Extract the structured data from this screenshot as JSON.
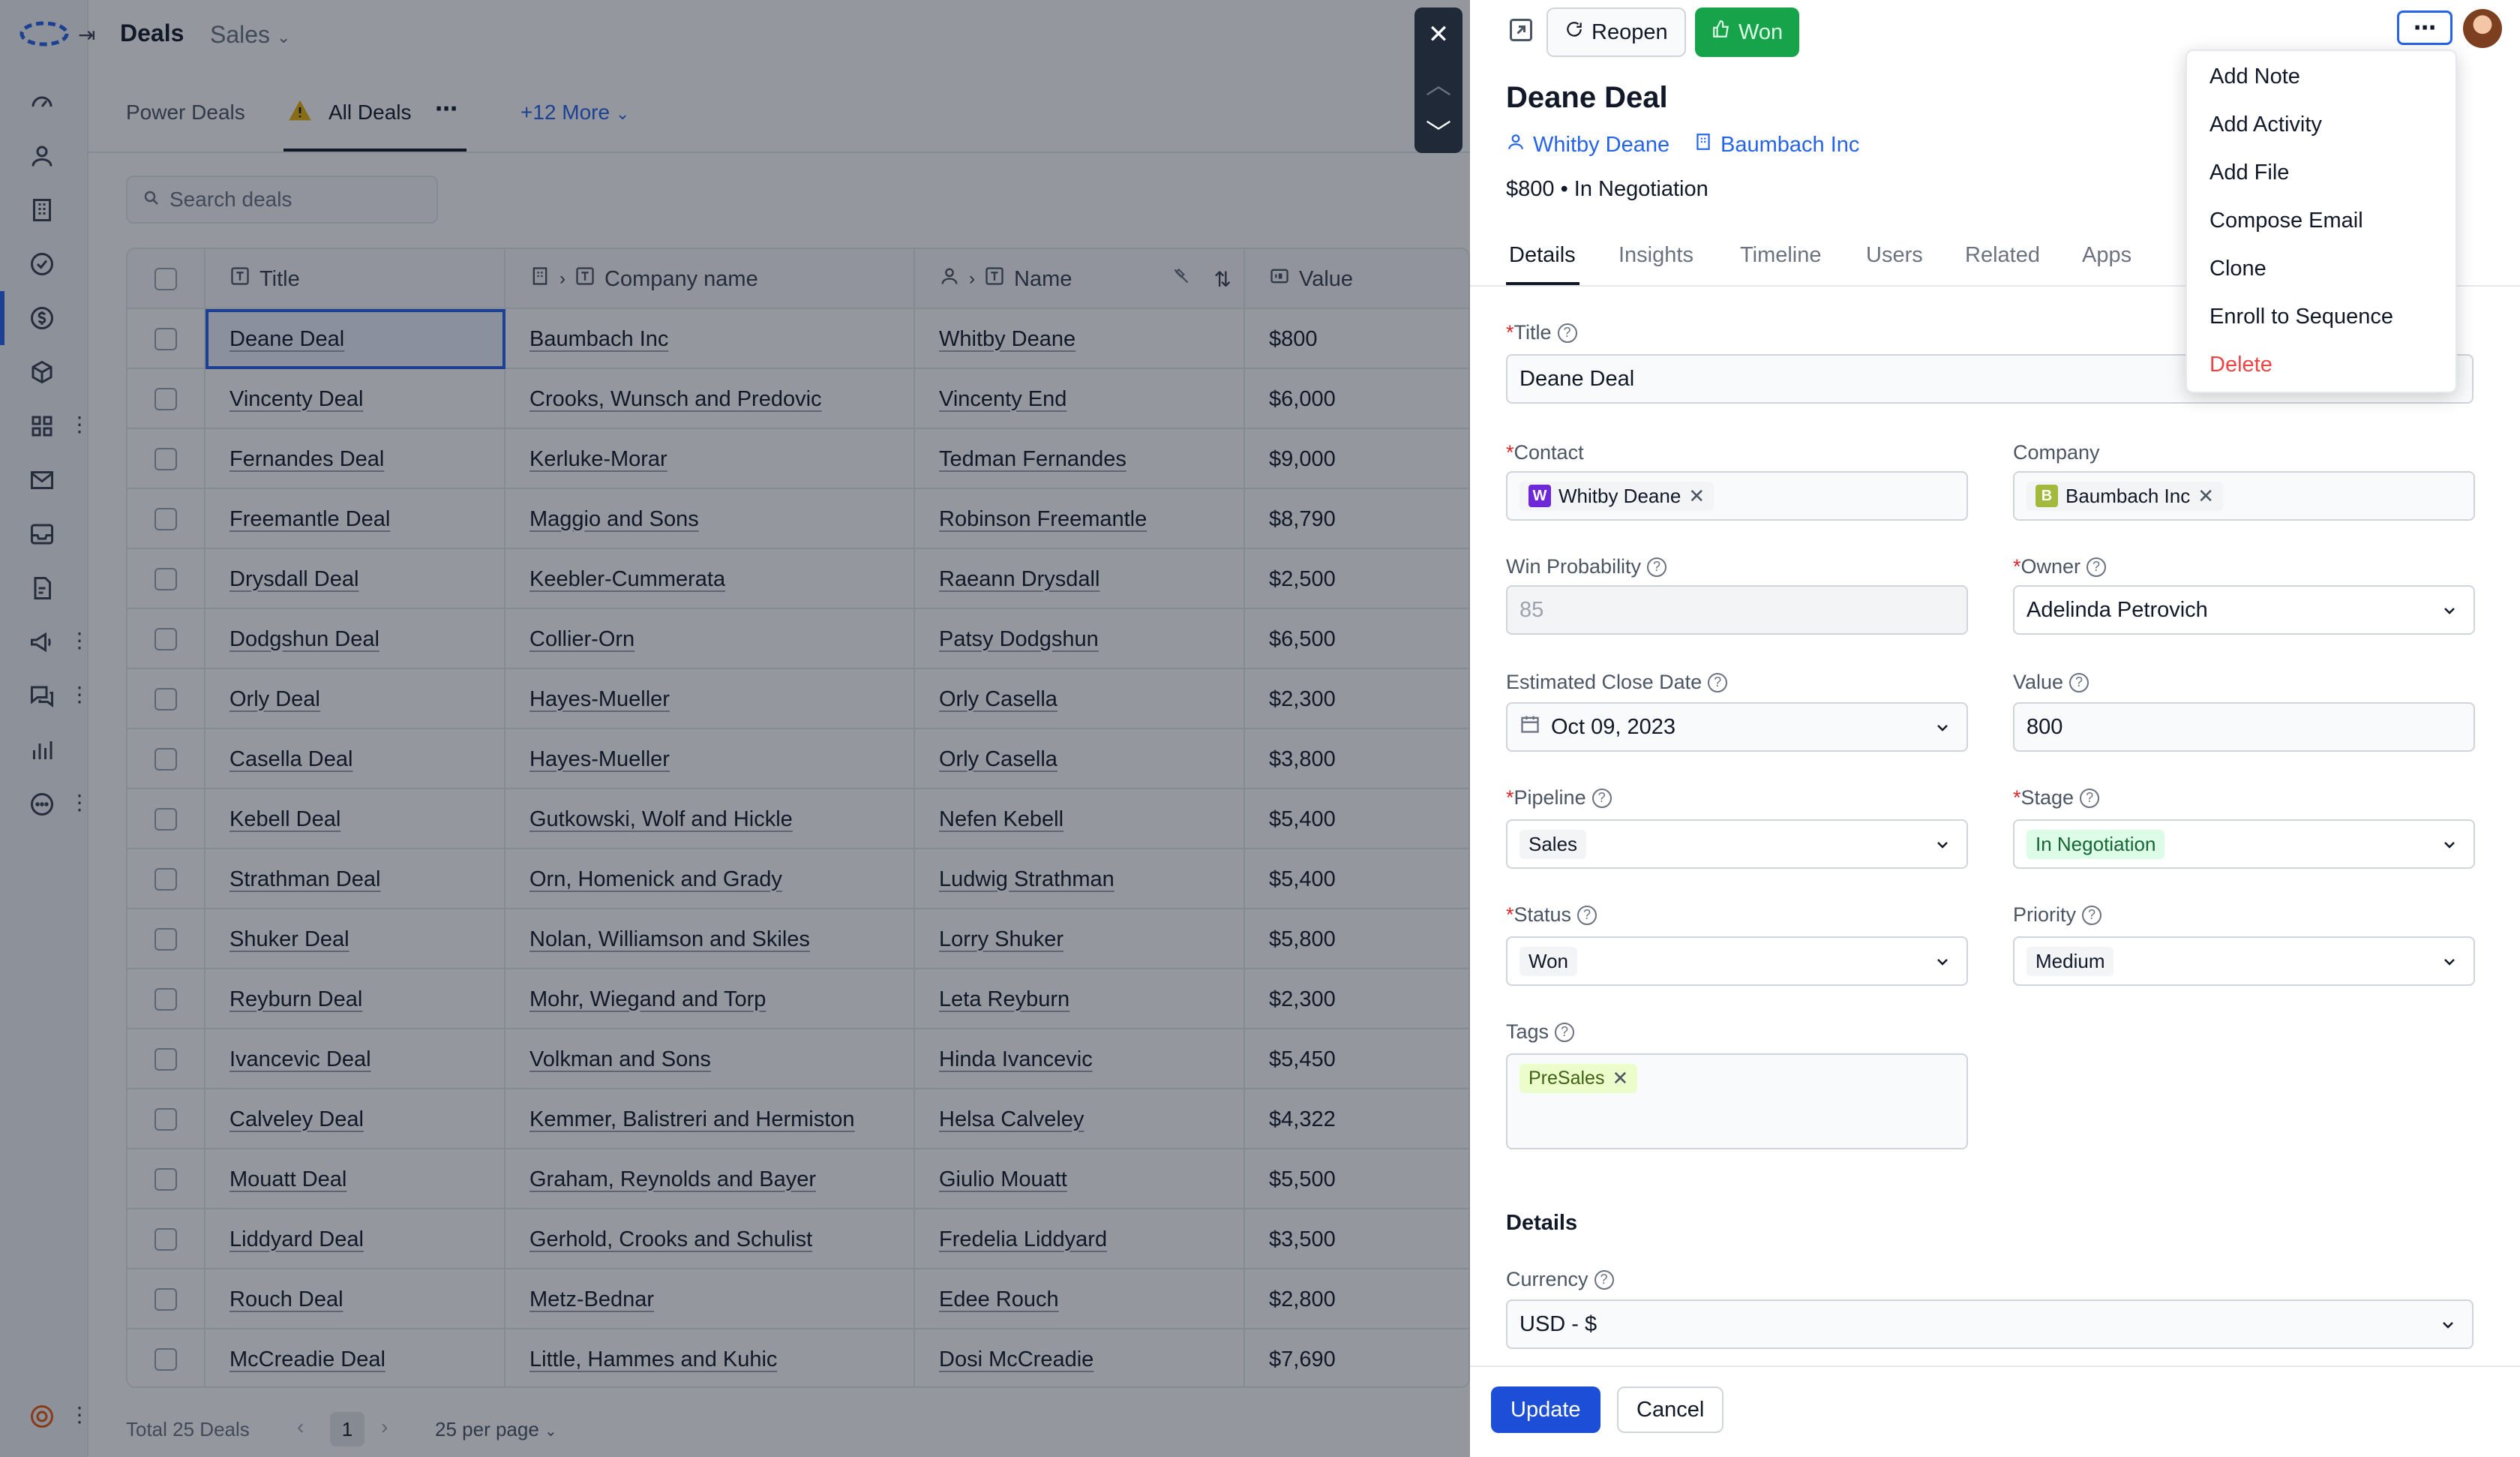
{
  "header": {
    "title": "Deals",
    "pipeline": "Sales"
  },
  "views": {
    "power_deals": "Power Deals",
    "all_deals": "All Deals",
    "more": "+12 More"
  },
  "search": {
    "placeholder": "Search deals"
  },
  "table": {
    "columns": [
      "Title",
      "Company name",
      "Name",
      "Value"
    ],
    "rows": [
      [
        "Deane Deal",
        "Baumbach Inc",
        "Whitby Deane",
        "$800"
      ],
      [
        "Vincenty Deal",
        "Crooks, Wunsch and Predovic",
        "Vincenty End",
        "$6,000"
      ],
      [
        "Fernandes Deal",
        "Kerluke-Morar",
        "Tedman Fernandes",
        "$9,000"
      ],
      [
        "Freemantle Deal",
        "Maggio and Sons",
        "Robinson Freemantle",
        "$8,790"
      ],
      [
        "Drysdall Deal",
        "Keebler-Cummerata",
        "Raeann Drysdall",
        "$2,500"
      ],
      [
        "Dodgshun Deal",
        "Collier-Orn",
        "Patsy Dodgshun",
        "$6,500"
      ],
      [
        "Orly Deal",
        "Hayes-Mueller",
        "Orly Casella",
        "$2,300"
      ],
      [
        "Casella Deal",
        "Hayes-Mueller",
        "Orly Casella",
        "$3,800"
      ],
      [
        "Kebell Deal",
        "Gutkowski, Wolf and Hickle",
        "Nefen Kebell",
        "$5,400"
      ],
      [
        "Strathman Deal",
        "Orn, Homenick and Grady",
        "Ludwig Strathman",
        "$5,400"
      ],
      [
        "Shuker Deal",
        "Nolan, Williamson and Skiles",
        "Lorry Shuker",
        "$5,800"
      ],
      [
        "Reyburn Deal",
        "Mohr, Wiegand and Torp",
        "Leta Reyburn",
        "$2,300"
      ],
      [
        "Ivancevic Deal",
        "Volkman and Sons",
        "Hinda Ivancevic",
        "$5,450"
      ],
      [
        "Calveley Deal",
        "Kemmer, Balistreri and Hermiston",
        "Helsa Calveley",
        "$4,322"
      ],
      [
        "Mouatt Deal",
        "Graham, Reynolds and Bayer",
        "Giulio Mouatt",
        "$5,500"
      ],
      [
        "Liddyard Deal",
        "Gerhold, Crooks and Schulist",
        "Fredelia Liddyard",
        "$3,500"
      ],
      [
        "Rouch Deal",
        "Metz-Bednar",
        "Edee Rouch",
        "$2,800"
      ],
      [
        "McCreadie Deal",
        "Little, Hammes and Kuhic",
        "Dosi McCreadie",
        "$7,690"
      ]
    ]
  },
  "footer": {
    "total": "Total 25 Deals",
    "page": "1",
    "per_page": "25 per page"
  },
  "panel": {
    "reopen": "Reopen",
    "won": "Won",
    "title": "Deane Deal",
    "contact_link": "Whitby Deane",
    "company_link": "Baumbach Inc",
    "amount": "$800",
    "stage_text": "In Negotiation",
    "tabs": [
      "Details",
      "Insights",
      "Timeline",
      "Users",
      "Related",
      "Apps"
    ],
    "fields": {
      "title_label": "Title",
      "title_value": "Deane Deal",
      "contact_label": "Contact",
      "contact_value": "Whitby Deane",
      "contact_initial": "W",
      "company_label": "Company",
      "company_value": "Baumbach Inc",
      "company_initial": "B",
      "winprob_label": "Win Probability",
      "winprob_value": "85",
      "owner_label": "Owner",
      "owner_value": "Adelinda Petrovich",
      "close_label": "Estimated Close Date",
      "close_value": "Oct 09, 2023",
      "value_label": "Value",
      "value_value": "800",
      "pipeline_label": "Pipeline",
      "pipeline_value": "Sales",
      "stage_label": "Stage",
      "stage_value": "In Negotiation",
      "status_label": "Status",
      "status_value": "Won",
      "priority_label": "Priority",
      "priority_value": "Medium",
      "tags_label": "Tags",
      "tag_value": "PreSales"
    },
    "details_heading": "Details",
    "currency_label": "Currency",
    "currency_value": "USD - $",
    "update": "Update",
    "cancel": "Cancel"
  },
  "menu": [
    "Add Note",
    "Add Activity",
    "Add File",
    "Compose Email",
    "Clone",
    "Enroll to Sequence",
    "Delete"
  ],
  "colors": {
    "accent": "#2563eb",
    "won": "#16a34a",
    "danger": "#ef4444",
    "stage_bg": "#dcfce7"
  }
}
